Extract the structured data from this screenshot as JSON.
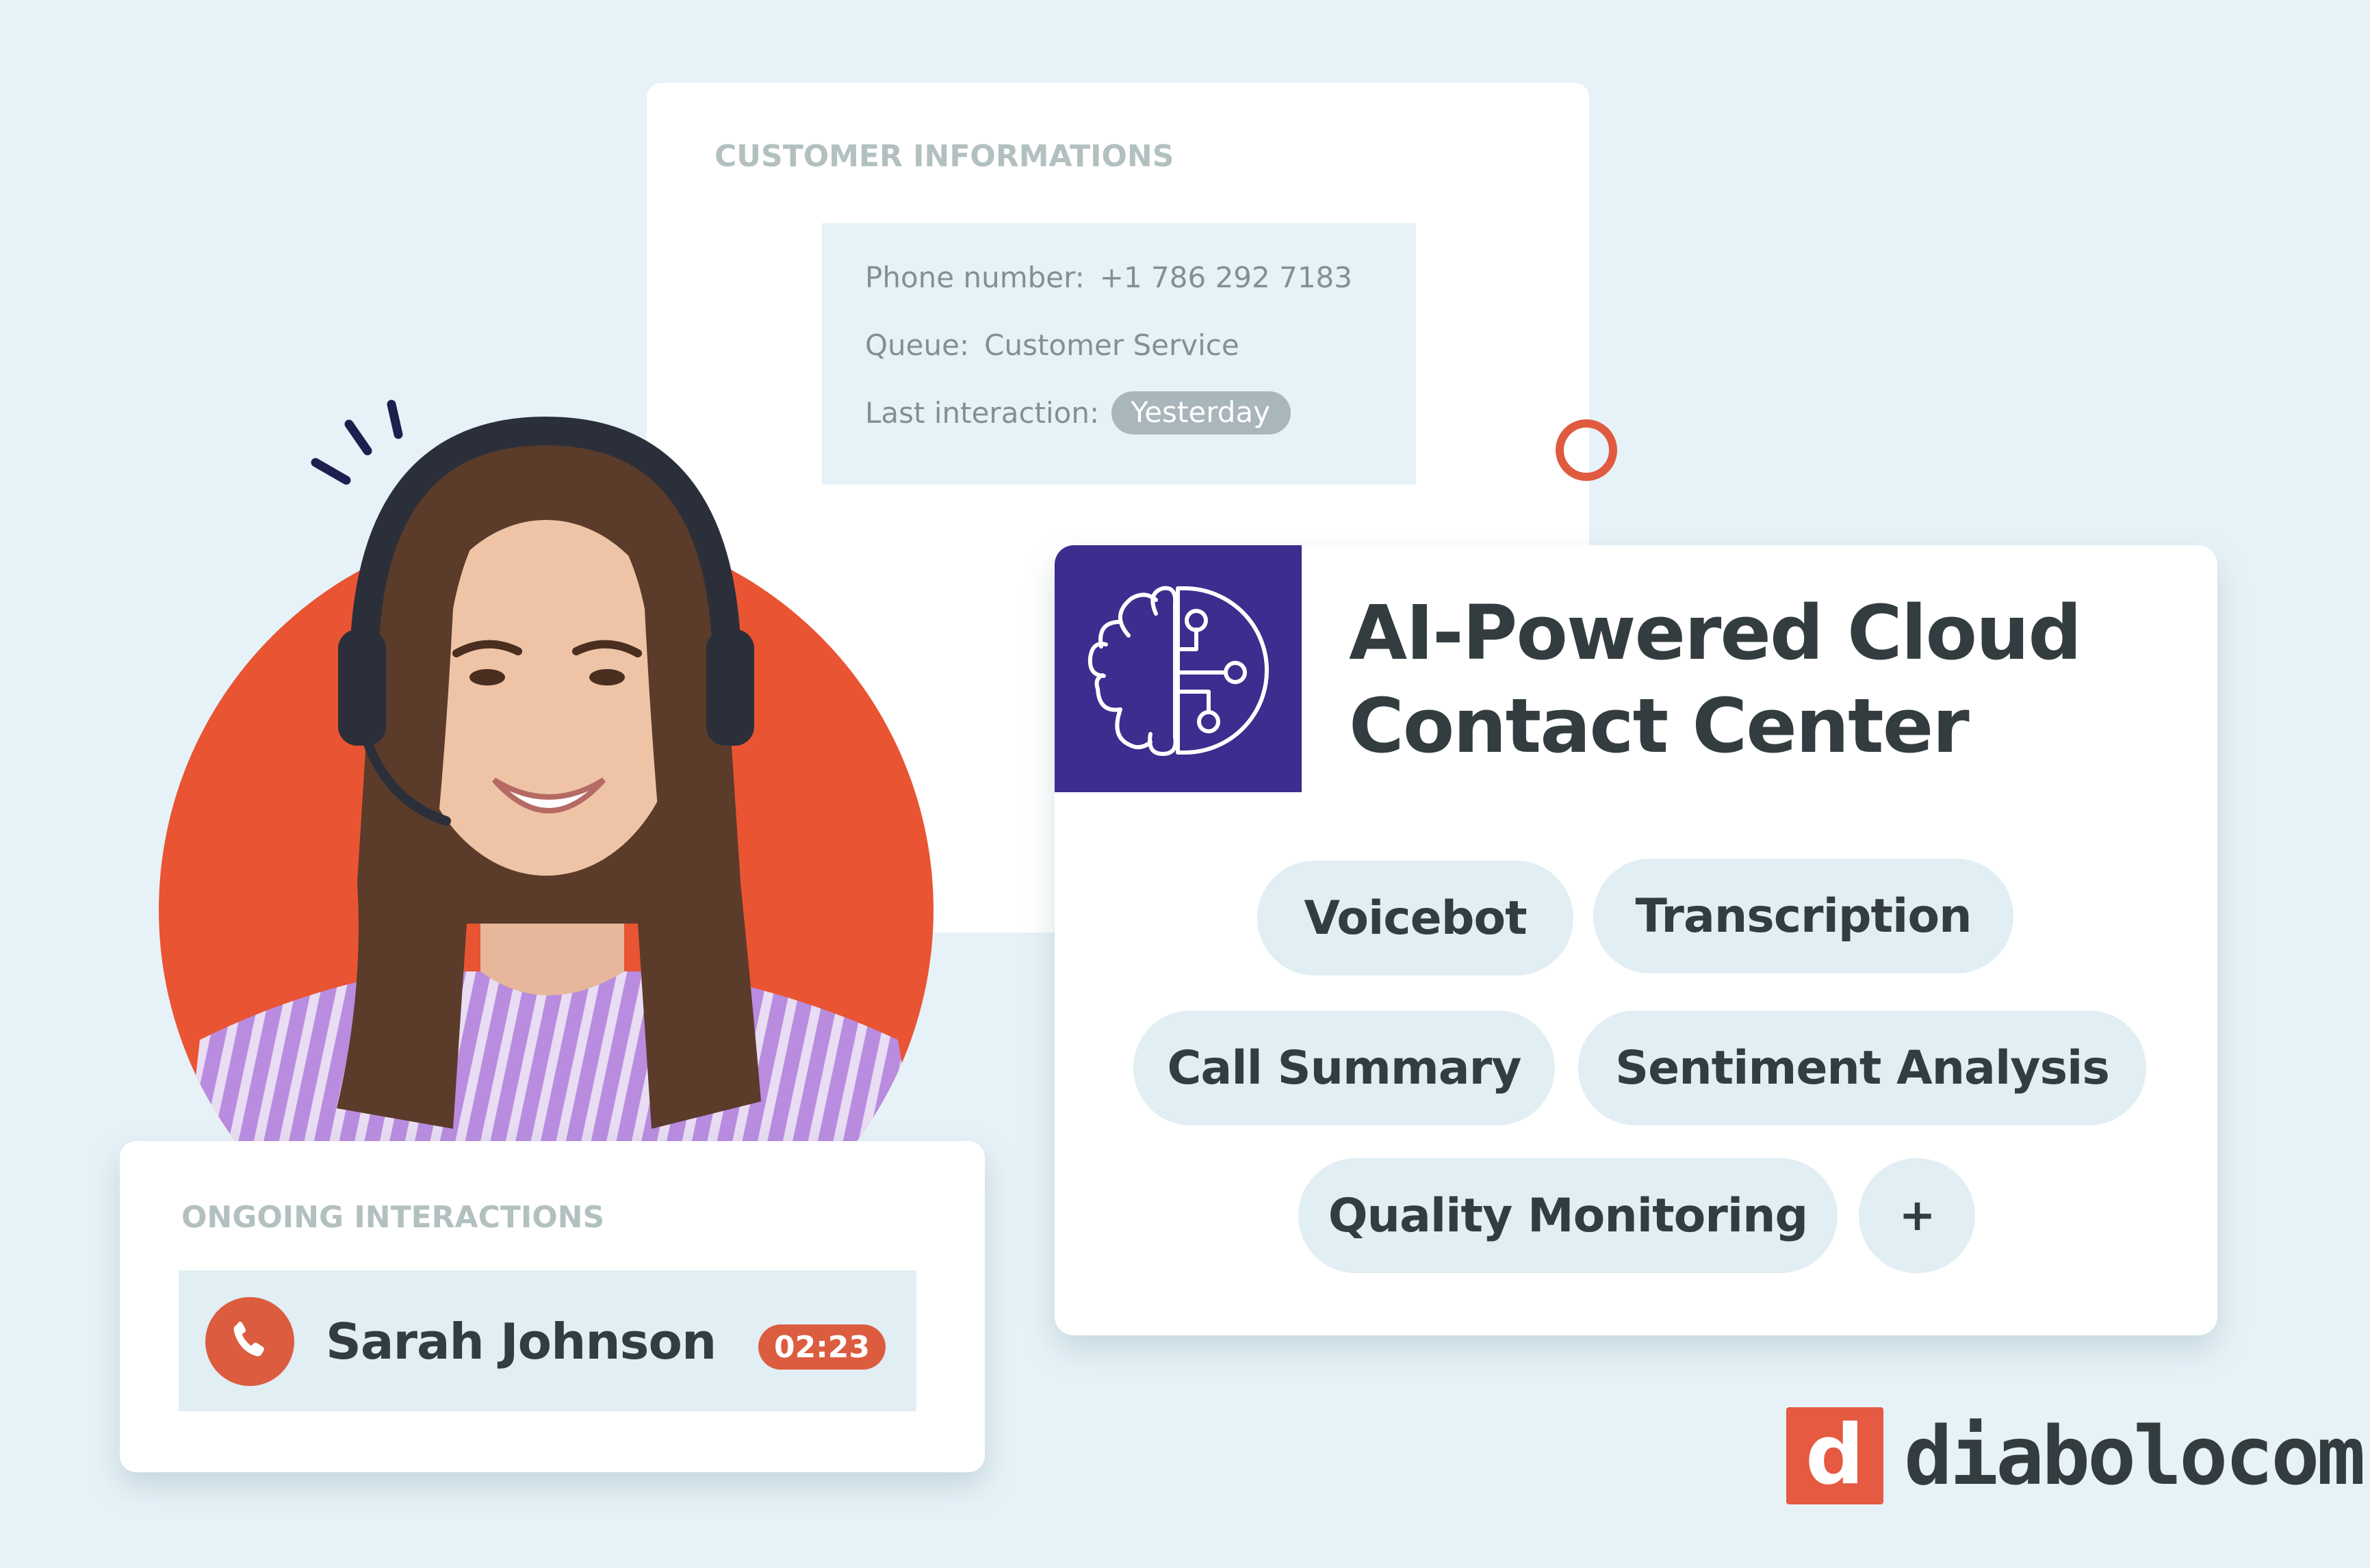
{
  "customer_card": {
    "title": "CUSTOMER INFORMATIONS",
    "fields": [
      {
        "label": "Phone number:",
        "value": "+1 786 292 7183"
      },
      {
        "label": "Queue:",
        "value": "Customer Service"
      },
      {
        "label": "Last interaction:",
        "value": "Yesterday"
      }
    ]
  },
  "ai_card": {
    "icon": "brain-circuit-icon",
    "title_line1": "AI-Powered Cloud",
    "title_line2": "Contact Center",
    "features": [
      "Voicebot",
      "Transcription",
      "Call Summary",
      "Sentiment Analysis",
      "Quality Monitoring",
      "+"
    ]
  },
  "ongoing_card": {
    "title": "ONGOING INTERACTIONS",
    "interaction": {
      "icon": "phone-icon",
      "contact_name": "Sarah Johnson",
      "duration": "02:23"
    }
  },
  "portrait": {
    "description": "Smiling agent wearing a headset"
  },
  "brand": {
    "logo_mark": "d",
    "name": "diabolocom"
  },
  "colors": {
    "background": "#e7f2f8",
    "accent_orange": "#dc5c40",
    "brand_purple": "#3c2d8e",
    "chip_bg": "#e1eef3",
    "text_dark": "#333d40",
    "label_grey": "#b3c0c0"
  }
}
